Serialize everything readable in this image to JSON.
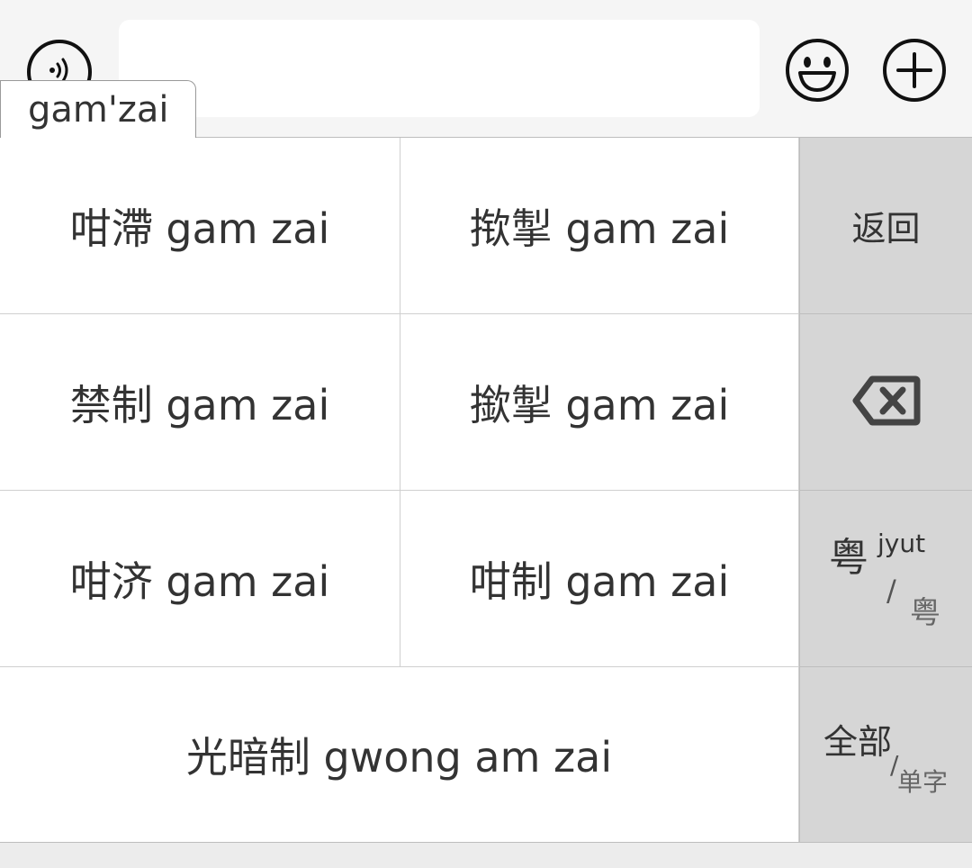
{
  "topbar": {
    "input_value": "",
    "input_placeholder": ""
  },
  "composing": "gam'zai",
  "candidates": [
    {
      "text": "咁滯 gam zai"
    },
    {
      "text": "揿掣 gam zai"
    },
    {
      "text": "禁制 gam zai"
    },
    {
      "text": "撳掣 gam zai"
    },
    {
      "text": "咁济 gam zai"
    },
    {
      "text": "咁制 gam zai"
    },
    {
      "text": "光暗制 gwong am zai"
    }
  ],
  "side": {
    "back_label": "返回",
    "mode_main": "粤",
    "mode_sup": "jyut",
    "mode_slash": "/",
    "mode_alt": "粤",
    "filter_main": "全部",
    "filter_slash": "/",
    "filter_alt": "单字"
  },
  "colors": {
    "key_bg": "#ffffff",
    "side_bg": "#d6d6d6",
    "text": "#333333"
  },
  "icons": [
    "voice-icon",
    "emoji-icon",
    "plus-icon",
    "backspace-icon"
  ]
}
